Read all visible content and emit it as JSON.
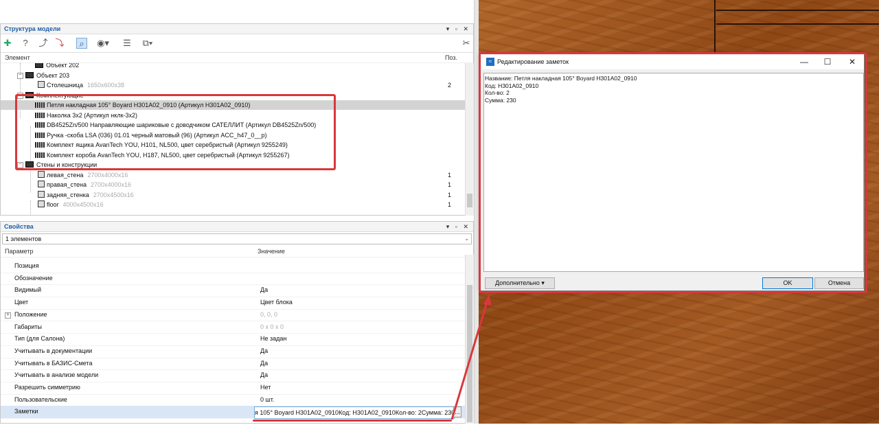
{
  "model_structure": {
    "title": "Структура модели",
    "panel_controls": [
      "▾",
      "▫",
      "✕"
    ],
    "toolbar_icons": [
      "add-node-icon",
      "help-node-icon",
      "connect-icon",
      "disconnect-icon",
      "find-icon",
      "view-icon",
      "list-icon",
      "group-icon",
      "settings-icon"
    ],
    "columns": {
      "element": "Элемент",
      "pos": "Поз."
    },
    "rows": [
      {
        "label": "Объект 202",
        "dim": "",
        "qty": "",
        "icon": "box"
      },
      {
        "label": "Объект 203",
        "dim": "",
        "qty": "",
        "icon": "box"
      },
      {
        "label": "Столешница",
        "dim": "1650x600x38",
        "qty": "2",
        "icon": "panel"
      },
      {
        "label": "Комплектующие",
        "dim": "",
        "qty": "",
        "icon": "box"
      },
      {
        "label": "Петля накладная 105° Boyard H301A02_0910 (Артикул H301A02_0910)",
        "dim": "",
        "qty": "",
        "icon": "item"
      },
      {
        "label": "Наколка 3x2 (Артикул нклк-3x2)",
        "dim": "",
        "qty": "",
        "icon": "item"
      },
      {
        "label": "DB4525Zn/500 Направляющие шариковые с доводчиком САТЕЛЛИТ (Артикул DB4525Zn/500)",
        "dim": "",
        "qty": "",
        "icon": "item"
      },
      {
        "label": "Ручка -скоба LSA (036) 01.01 черный матовый  (96) (Артикул ACC_h47_0__p)",
        "dim": "",
        "qty": "",
        "icon": "item"
      },
      {
        "label": "Комплект ящика AvanTech YOU, H101, NL500, цвет серебристый (Артикул 9255249)",
        "dim": "",
        "qty": "",
        "icon": "item"
      },
      {
        "label": "Комплект короба AvanTech YOU, H187, NL500, цвет серебристый (Артикул 9255267)",
        "dim": "",
        "qty": "",
        "icon": "item"
      },
      {
        "label": "Стены и конструкции",
        "dim": "",
        "qty": "",
        "icon": "box"
      },
      {
        "label": "левая_стена",
        "dim": "2700x4000x16",
        "qty": "1",
        "icon": "panel"
      },
      {
        "label": "правая_стена",
        "dim": "2700x4000x16",
        "qty": "1",
        "icon": "panel"
      },
      {
        "label": "задняя_стенка",
        "dim": "2700x4500x16",
        "qty": "1",
        "icon": "panel"
      },
      {
        "label": "floor",
        "dim": "4000x4500x16",
        "qty": "1",
        "icon": "panel"
      }
    ]
  },
  "properties": {
    "title": "Свойства",
    "panel_controls": [
      "▾",
      "▫",
      "✕"
    ],
    "combo_value": "1 элементов",
    "columns": {
      "param": "Параметр",
      "value": "Значение"
    },
    "rows": [
      {
        "name": "Позиция",
        "value": ""
      },
      {
        "name": "Обозначение",
        "value": ""
      },
      {
        "name": "Видимый",
        "value": "Да"
      },
      {
        "name": "Цвет",
        "value": "Цвет блока"
      },
      {
        "name": "Положение",
        "value": "0, 0, 0"
      },
      {
        "name": "Габариты",
        "value": "0 x 0 x 0"
      },
      {
        "name": "Тип (для Салона)",
        "value": "Не задан"
      },
      {
        "name": "Учитывать в документации",
        "value": "Да"
      },
      {
        "name": "Учитывать в БАЗИС-Смета",
        "value": "Да"
      },
      {
        "name": "Учитывать в анализе модели",
        "value": "Да"
      },
      {
        "name": "Разрешить симметрию",
        "value": "Нет"
      },
      {
        "name": "Пользовательские",
        "value": "0 шт."
      },
      {
        "name": "Заметки",
        "value": ""
      }
    ],
    "notes_value": "я 105° Boyard H301A02_0910Код: H301A02_0910Кол-во: 2Сумма: 230",
    "notes_button": "..."
  },
  "dialog": {
    "title": "Редактирование заметок",
    "lines": [
      "Название: Петля накладная 105° Boyard H301A02_0910",
      "Код: H301A02_0910",
      "Кол-во: 2",
      "Сумма: 230"
    ],
    "more_button": "Дополнительно ▾",
    "ok_button": "OK",
    "cancel_button": "Отмена",
    "window_buttons": {
      "minimize": "—",
      "maximize": "☐",
      "close": "✕"
    }
  },
  "colors": {
    "accent": "#1f5fa8",
    "annotation": "#d9373c",
    "selection": "#d3d3d3"
  }
}
